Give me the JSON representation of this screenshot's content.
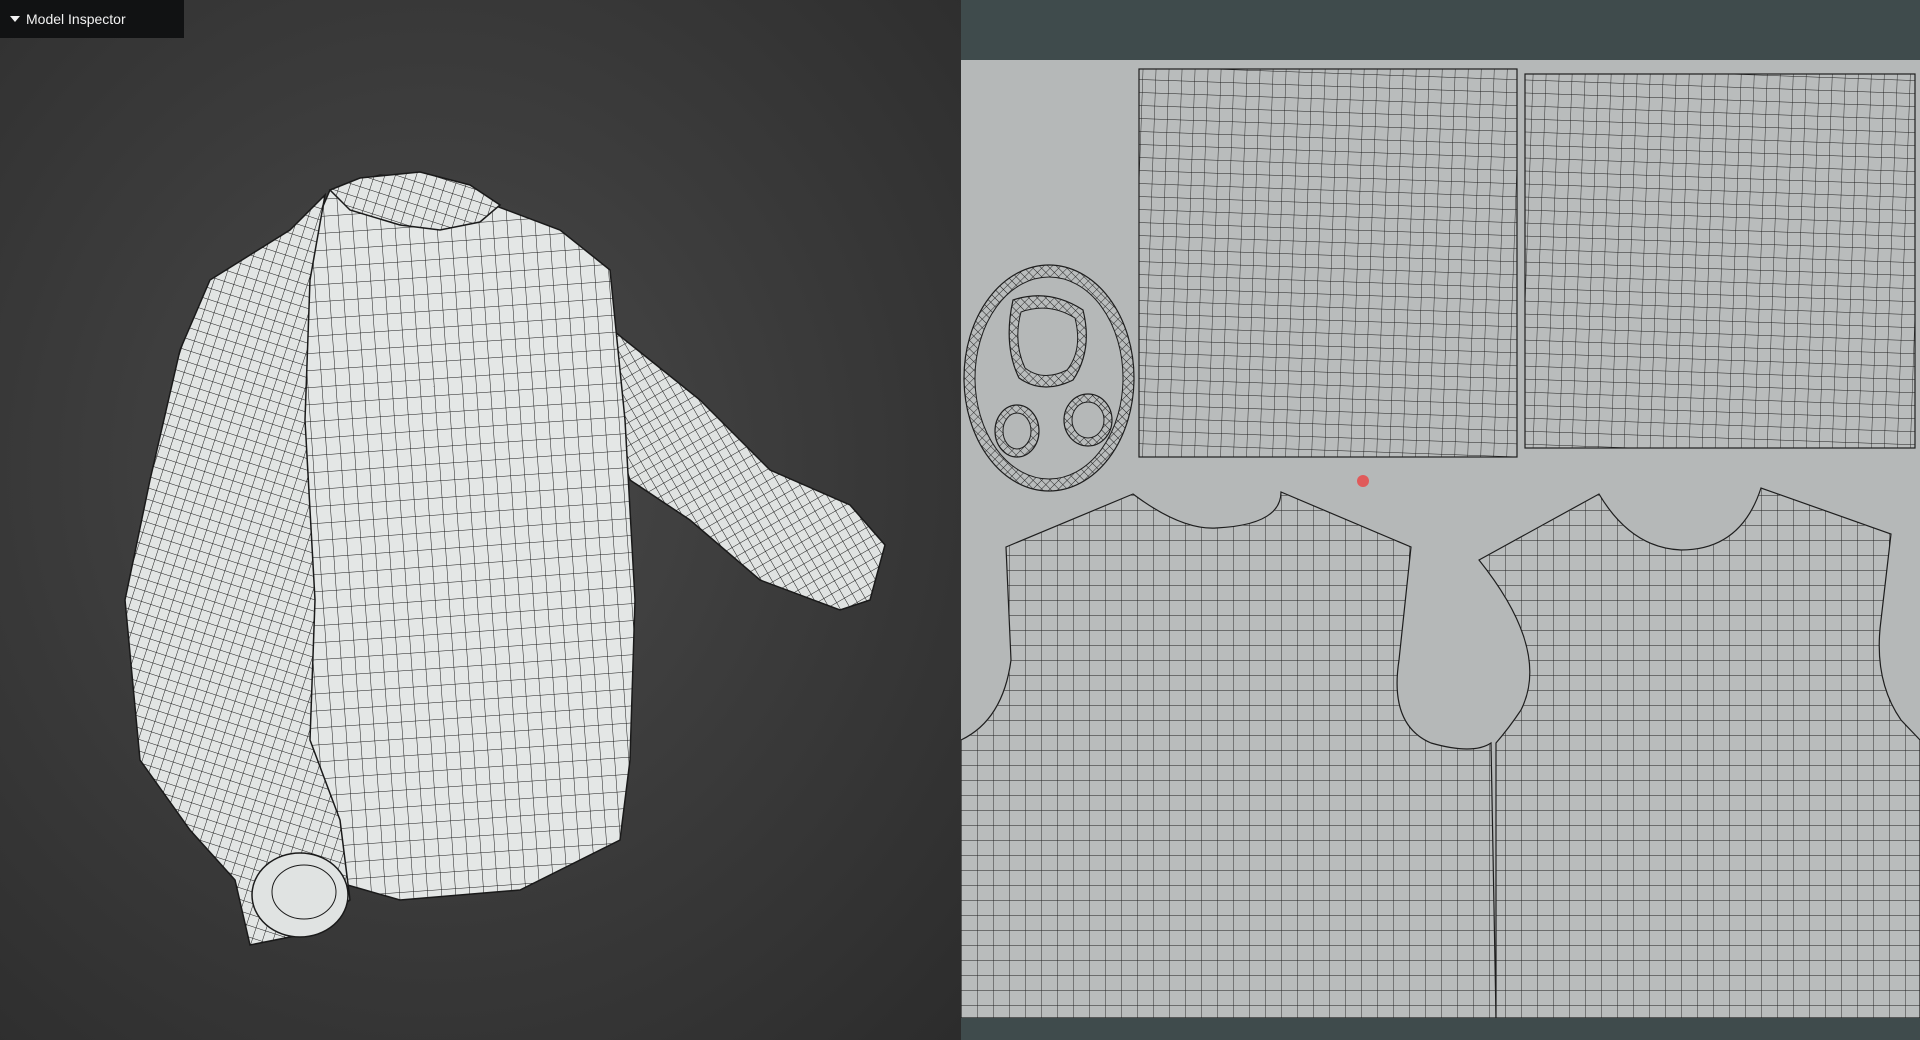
{
  "inspector": {
    "title": "Model Inspector",
    "expanded": true,
    "toggle_icon": "triangle-down-icon"
  },
  "viewport": {
    "name": "3d-viewport",
    "object": "sweater-mesh",
    "display": "wireframe-over-solid"
  },
  "uv_editor": {
    "name": "uv-editor",
    "island_count": 7
  },
  "colors": {
    "viewport_bg": "#3a3a3a",
    "mesh_fill": "#e4e7e6",
    "wire": "#1a1a1a",
    "uv_bg": "#b5b8b8",
    "uv_frame": "#3f4b4c",
    "cursor": "#e05a5a"
  }
}
